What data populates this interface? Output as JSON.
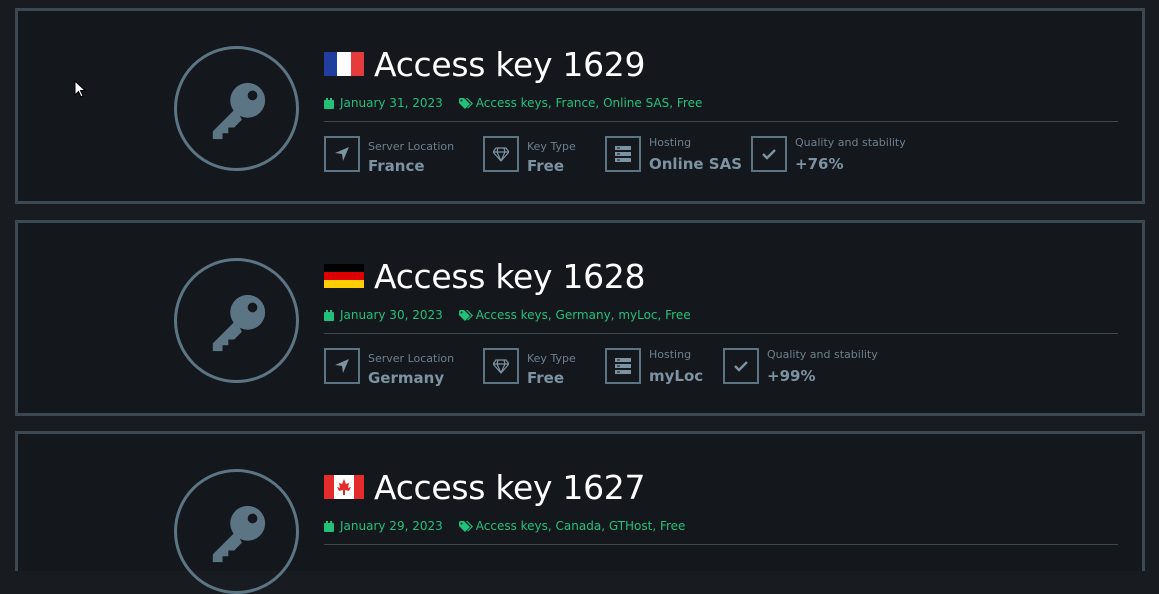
{
  "cards": [
    {
      "title": "Access key 1629",
      "flag": "france",
      "date": "January 31, 2023",
      "tags": "Access keys, France, Online SAS, Free",
      "attributes": [
        {
          "label": "Server Location",
          "value": "France",
          "icon": "location-arrow-icon"
        },
        {
          "label": "Key Type",
          "value": "Free",
          "icon": "diamond-icon"
        },
        {
          "label": "Hosting",
          "value": "Online SAS",
          "icon": "server-icon"
        },
        {
          "label": "Quality and stability",
          "value": "+76%",
          "icon": "checkmark-icon"
        }
      ]
    },
    {
      "title": "Access key 1628",
      "flag": "germany",
      "date": "January 30, 2023",
      "tags": "Access keys, Germany, myLoc, Free",
      "attributes": [
        {
          "label": "Server Location",
          "value": "Germany",
          "icon": "location-arrow-icon"
        },
        {
          "label": "Key Type",
          "value": "Free",
          "icon": "diamond-icon"
        },
        {
          "label": "Hosting",
          "value": "myLoc",
          "icon": "server-icon"
        },
        {
          "label": "Quality and stability",
          "value": "+99%",
          "icon": "checkmark-icon"
        }
      ]
    },
    {
      "title": "Access key 1627",
      "flag": "canada",
      "date": "January 29, 2023",
      "tags": "Access keys, Canada, GTHost, Free"
    }
  ],
  "colors": {
    "background": "#181b1f",
    "card_border": "#3d4952",
    "accent_green": "#22c17a",
    "icon_gray": "#5c7585",
    "title_white": "#ffffff"
  }
}
